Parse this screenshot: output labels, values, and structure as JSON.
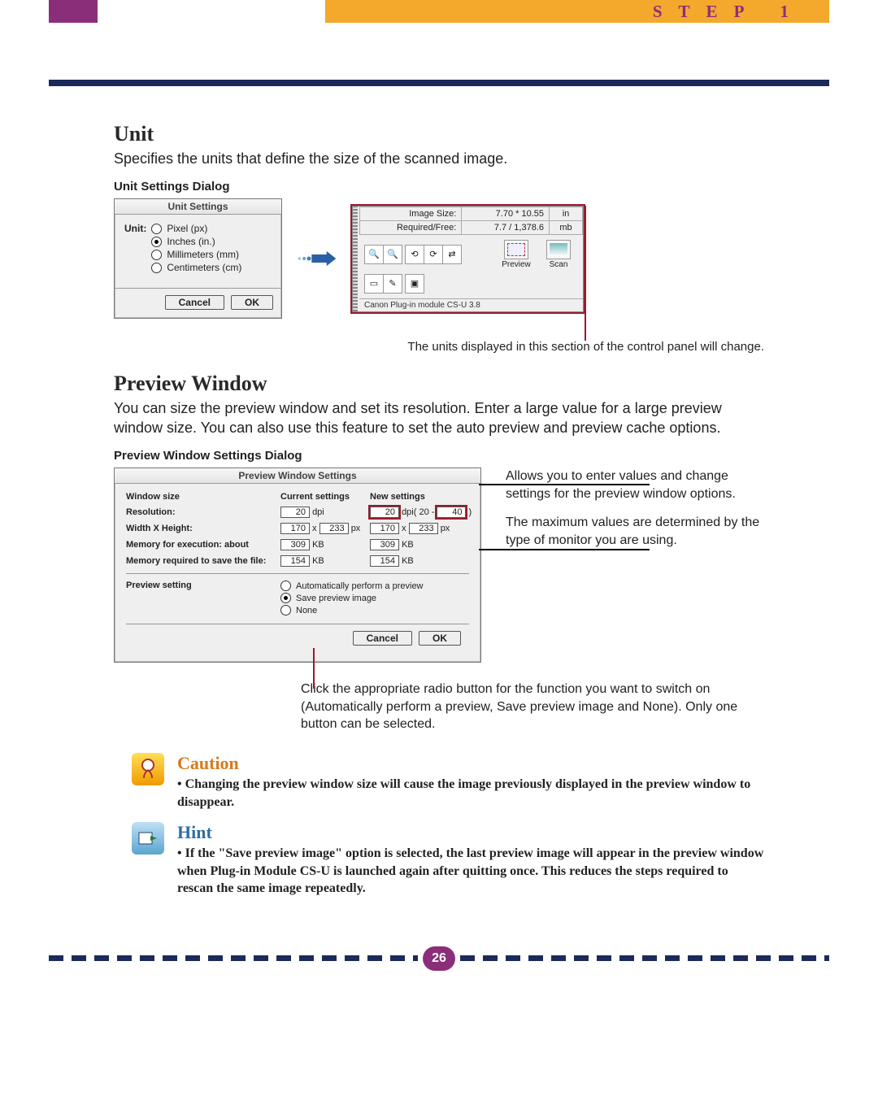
{
  "header": {
    "step_label": "STEP 1"
  },
  "unit_section": {
    "heading": "Unit",
    "desc": "Specifies the units that define the size of the scanned image.",
    "caption": "Unit Settings Dialog",
    "dialog": {
      "title": "Unit Settings",
      "label": "Unit:",
      "options": [
        "Pixel (px)",
        "Inches (in.)",
        "Millimeters (mm)",
        "Centimeters (cm)"
      ],
      "selected": 1,
      "cancel": "Cancel",
      "ok": "OK"
    },
    "panel": {
      "image_size_label": "Image Size:",
      "image_size_value": "7.70 * 10.55",
      "image_size_unit": "in",
      "required_label": "Required/Free:",
      "required_value": "7.7 / 1,378.6",
      "required_unit": "mb",
      "preview_label": "Preview",
      "scan_label": "Scan",
      "footer": "Canon Plug-in module CS-U 3.8"
    },
    "note": "The units displayed in this section of the control panel will change."
  },
  "preview_section": {
    "heading": "Preview Window",
    "desc": "You can size the preview window and set its resolution. Enter a large value for a large preview window size. You can also use this feature to set the auto preview and preview cache options.",
    "caption": "Preview Window Settings Dialog",
    "dialog": {
      "title": "Preview Window Settings",
      "window_size": "Window size",
      "current": "Current settings",
      "newcol": "New settings",
      "rows": {
        "resolution": "Resolution:",
        "wxh": "Width X Height:",
        "mem_exec": "Memory for execution: about",
        "mem_save": "Memory required to save the file:",
        "preview_setting": "Preview setting"
      },
      "current_resolution": "20",
      "current_dpi": "dpi",
      "current_w": "170",
      "current_h": "233",
      "px": "px",
      "current_exec": "309",
      "kb": "KB",
      "current_save": "154",
      "new_resolution": "20",
      "new_dpi_paren": "dpi( 20",
      "new_max": "40",
      "close_paren": ")",
      "new_w": "170",
      "new_h": "233",
      "new_exec": "309",
      "new_save": "154",
      "radios": [
        "Automatically perform a preview",
        "Save preview image",
        "None"
      ],
      "selected_radio": 1,
      "cancel": "Cancel",
      "ok": "OK"
    },
    "side_note_1": "Allows you to enter values and change settings for the preview window options.",
    "side_note_2": "The maximum values are determined by the type of monitor you are using.",
    "radio_note": "Click the appropriate radio button for the function you want to switch on (Automatically perform a preview, Save preview image and None). Only one button can be selected."
  },
  "caution": {
    "heading": "Caution",
    "text": "• Changing the preview window size will cause the image previously displayed in the preview window to disappear."
  },
  "hint": {
    "heading": "Hint",
    "text": "• If the \"Save preview image\" option is selected, the last preview image will appear in the preview window when Plug-in Module CS-U is launched again after quitting once. This reduces the steps required to rescan the same image repeatedly."
  },
  "page_number": "26"
}
